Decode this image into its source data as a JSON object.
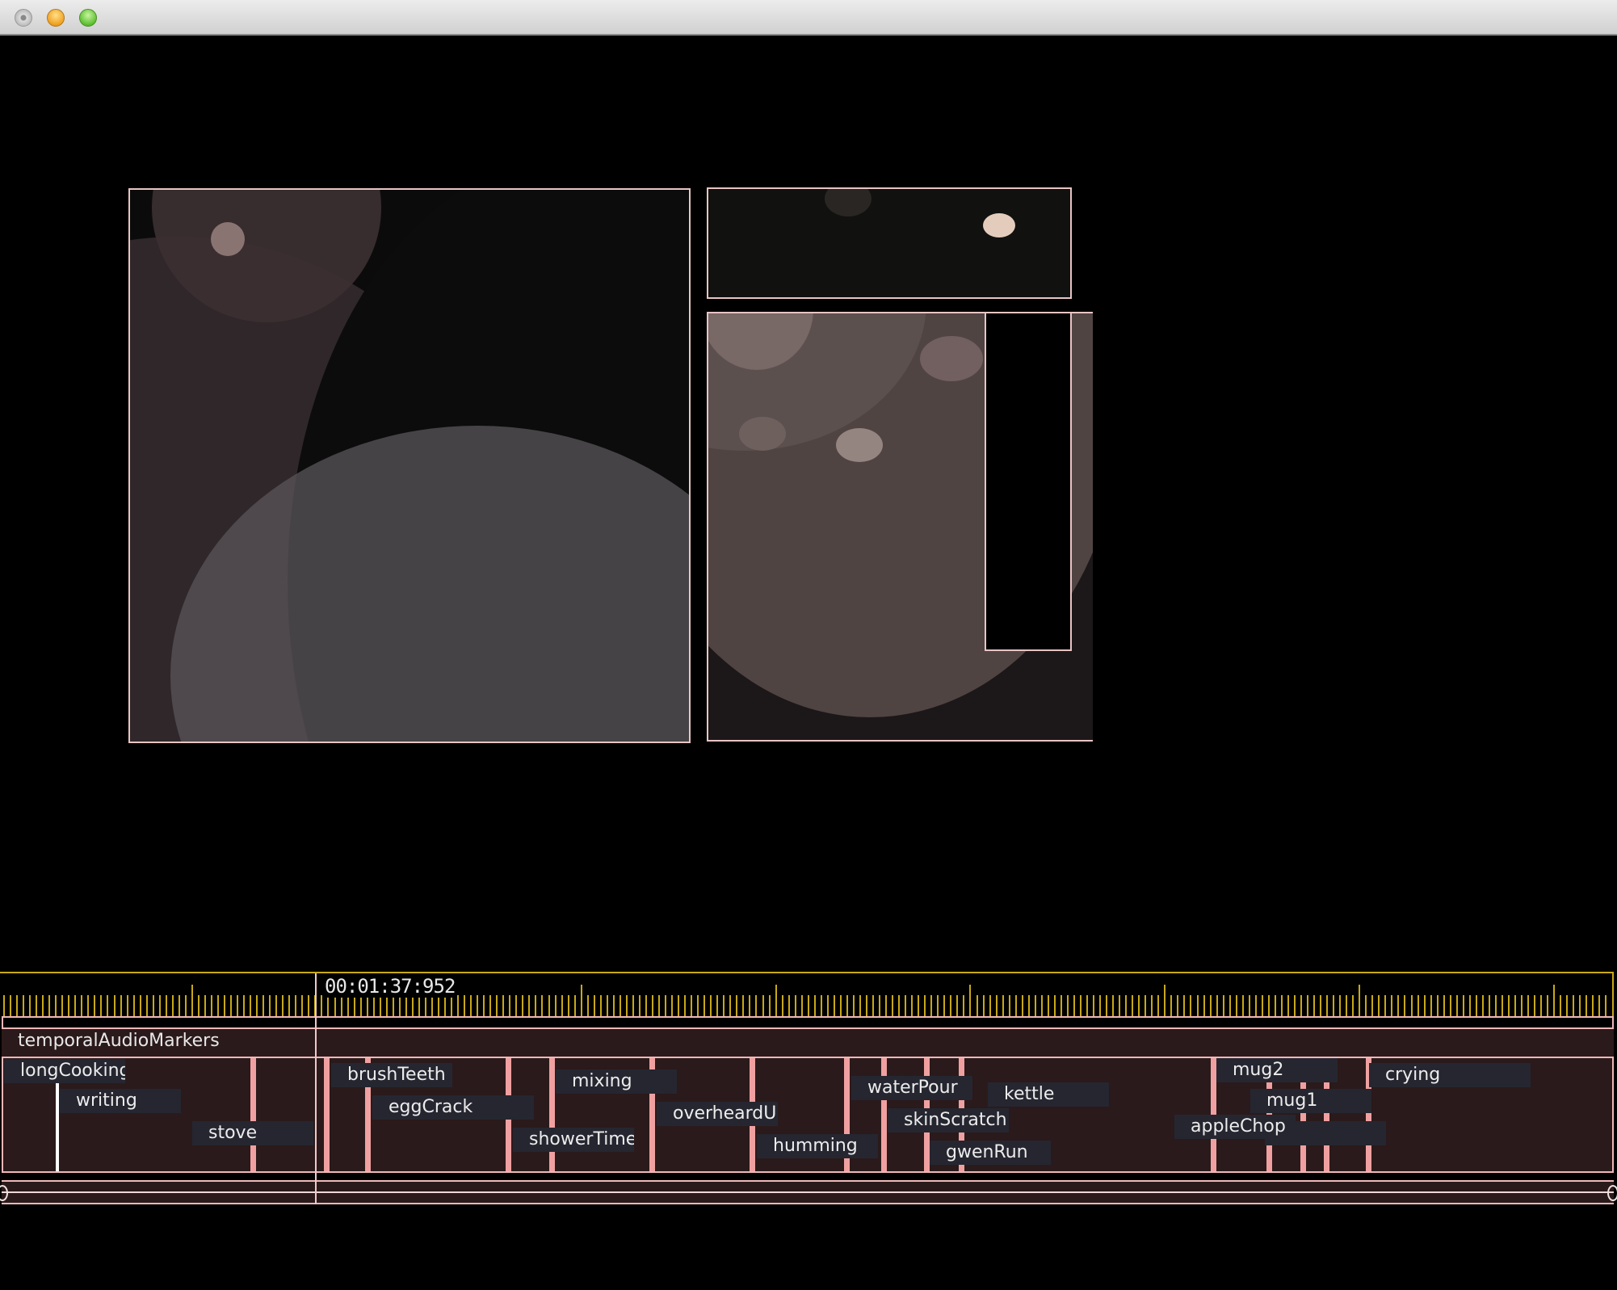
{
  "window": {
    "controls": [
      "close",
      "minimize",
      "zoom"
    ]
  },
  "colors": {
    "background": "#000000",
    "panel_border": "#e8c4c4",
    "ruler": "#c8a818",
    "track_bg": "#2b1a1b",
    "marker_line": "#f0a0a0",
    "label_bg": "#252630",
    "label_text": "#ececec"
  },
  "timeline": {
    "playhead_time": "00:01:37:952",
    "track_name": "temporalAudioMarkers",
    "markers": [
      {
        "label": "longCooking"
      },
      {
        "label": "writing"
      },
      {
        "label": "stove"
      },
      {
        "label": "brushTeeth"
      },
      {
        "label": "eggCrack"
      },
      {
        "label": "mixing"
      },
      {
        "label": "showerTime"
      },
      {
        "label": "overheardUpstairs"
      },
      {
        "label": "humming"
      },
      {
        "label": "waterPour"
      },
      {
        "label": "kettle"
      },
      {
        "label": "skinScratch"
      },
      {
        "label": "gwenRun"
      },
      {
        "label": "mug2"
      },
      {
        "label": "crying"
      },
      {
        "label": "mug1"
      },
      {
        "label": "appleChop"
      }
    ]
  }
}
